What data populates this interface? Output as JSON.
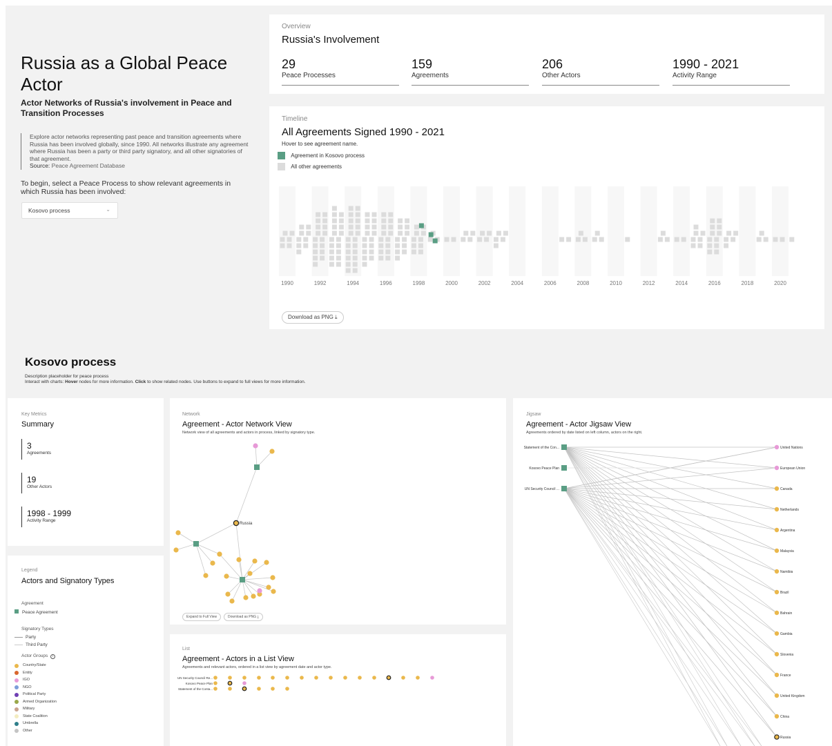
{
  "intro": {
    "title": "Russia as a Global Peace Actor",
    "subtitle": "Actor Networks of Russia's involvement in Peace and Transition Processes",
    "description": "Explore actor networks representing past peace and transition agreements where Russia has been involved globally, since 1990. All networks illustrate any agreement where Russia has been a party or third party signatory, and all other signatories of that agreement.",
    "source_label": "Source:",
    "source_link": "Peace Agreement Database",
    "prompt": "To begin, select a Peace Process to show relevant agreements in which Russia has been involved:",
    "select_value": "Kosovo process"
  },
  "overview": {
    "label": "Overview",
    "title": "Russia's Involvement",
    "stats": [
      {
        "value": "29",
        "label": "Peace Processes"
      },
      {
        "value": "159",
        "label": "Agreements"
      },
      {
        "value": "206",
        "label": "Other Actors"
      },
      {
        "value": "1990 - 2021",
        "label": "Activity Range"
      }
    ]
  },
  "timeline": {
    "label": "Timeline",
    "title": "All Agreements Signed 1990 - 2021",
    "hint": "Hover to see agreement name.",
    "legend": [
      "Agreement in Kosovo process",
      "All other agreements"
    ],
    "highlight_color": "#5a9e84",
    "other_color": "#dcdcdc",
    "download": "Download as PNG ⤓",
    "years": [
      "1990",
      "1992",
      "1994",
      "1996",
      "1998",
      "2000",
      "2002",
      "2004",
      "2006",
      "2008",
      "2010",
      "2012",
      "2014",
      "2016",
      "2018",
      "2020"
    ]
  },
  "process": {
    "title": "Kosovo process",
    "description": "Description placeholder for peace process",
    "instr_pre": "Interact with charts: ",
    "instr_hover": "Hover",
    "instr_mid": " nodes for more information. ",
    "instr_click": "Click",
    "instr_post": " to show related nodes. Use buttons to expand to full views for more information."
  },
  "summary": {
    "label": "Key Metrics",
    "title": "Summary",
    "metrics": [
      {
        "value": "3",
        "label": "Agreements"
      },
      {
        "value": "19",
        "label": "Other Actors"
      },
      {
        "value": "1998 - 1999",
        "label": "Activity Range"
      }
    ]
  },
  "legend": {
    "label": "Legend",
    "title": "Actors and Signatory Types",
    "agreement_heading": "Agreement",
    "agreement_item": "Peace Agreement",
    "signatory_heading": "Signatory Types",
    "signatory_items": [
      "Party",
      "Third Party"
    ],
    "actor_heading": "Actor Groups",
    "actor_groups": [
      {
        "name": "Country/State",
        "color": "#eab84c"
      },
      {
        "name": "Entity",
        "color": "#d9672e"
      },
      {
        "name": "IGO",
        "color": "#e79ad7"
      },
      {
        "name": "NGO",
        "color": "#7d9ed9"
      },
      {
        "name": "Political Party",
        "color": "#6f3fb3"
      },
      {
        "name": "Armed Organization",
        "color": "#9aa84a"
      },
      {
        "name": "Military",
        "color": "#caa38f"
      },
      {
        "name": "State Coalition",
        "color": "#f3ecc0"
      },
      {
        "name": "Umbrella",
        "color": "#2f7f8a"
      },
      {
        "name": "Other",
        "color": "#c4c4c4"
      }
    ]
  },
  "network": {
    "label": "Network",
    "title": "Agreement - Actor Network View",
    "subtitle": "Network view of all agreements and actors in process, linked by signatory type.",
    "russia_label": "Russia",
    "expand": "Expand to Full View",
    "download": "Download as PNG ⤓"
  },
  "list": {
    "label": "List",
    "title": "Agreement - Actors in a List View",
    "subtitle": "Agreements and relevant actors, ordered in a list view by agreement date and actor type.",
    "rows": [
      "UN Security Council Re...",
      "Kosovo Peace Plan",
      "Statement of the Conta..."
    ]
  },
  "jigsaw": {
    "label": "Jigsaw",
    "title": "Agreement - Actor Jigsaw View",
    "subtitle": "Agreements ordered by date listed on left column, actors on the right.",
    "agreements": [
      "Statement of the Con...",
      "Kosovo Peace Plan",
      "UN Security Council ..."
    ],
    "actors": [
      "United Nations",
      "European Union",
      "Canada",
      "Netherlands",
      "Argentina",
      "Malaysia",
      "Namibia",
      "Brazil",
      "Bahrain",
      "Gambia",
      "Slovenia",
      "France",
      "United Kingdom",
      "China",
      "Russia"
    ],
    "actor_types": [
      "IGO",
      "IGO",
      "Country/State",
      "Country/State",
      "Country/State",
      "Country/State",
      "Country/State",
      "Country/State",
      "Country/State",
      "Country/State",
      "Country/State",
      "Country/State",
      "Country/State",
      "Country/State",
      "Country/State"
    ]
  }
}
